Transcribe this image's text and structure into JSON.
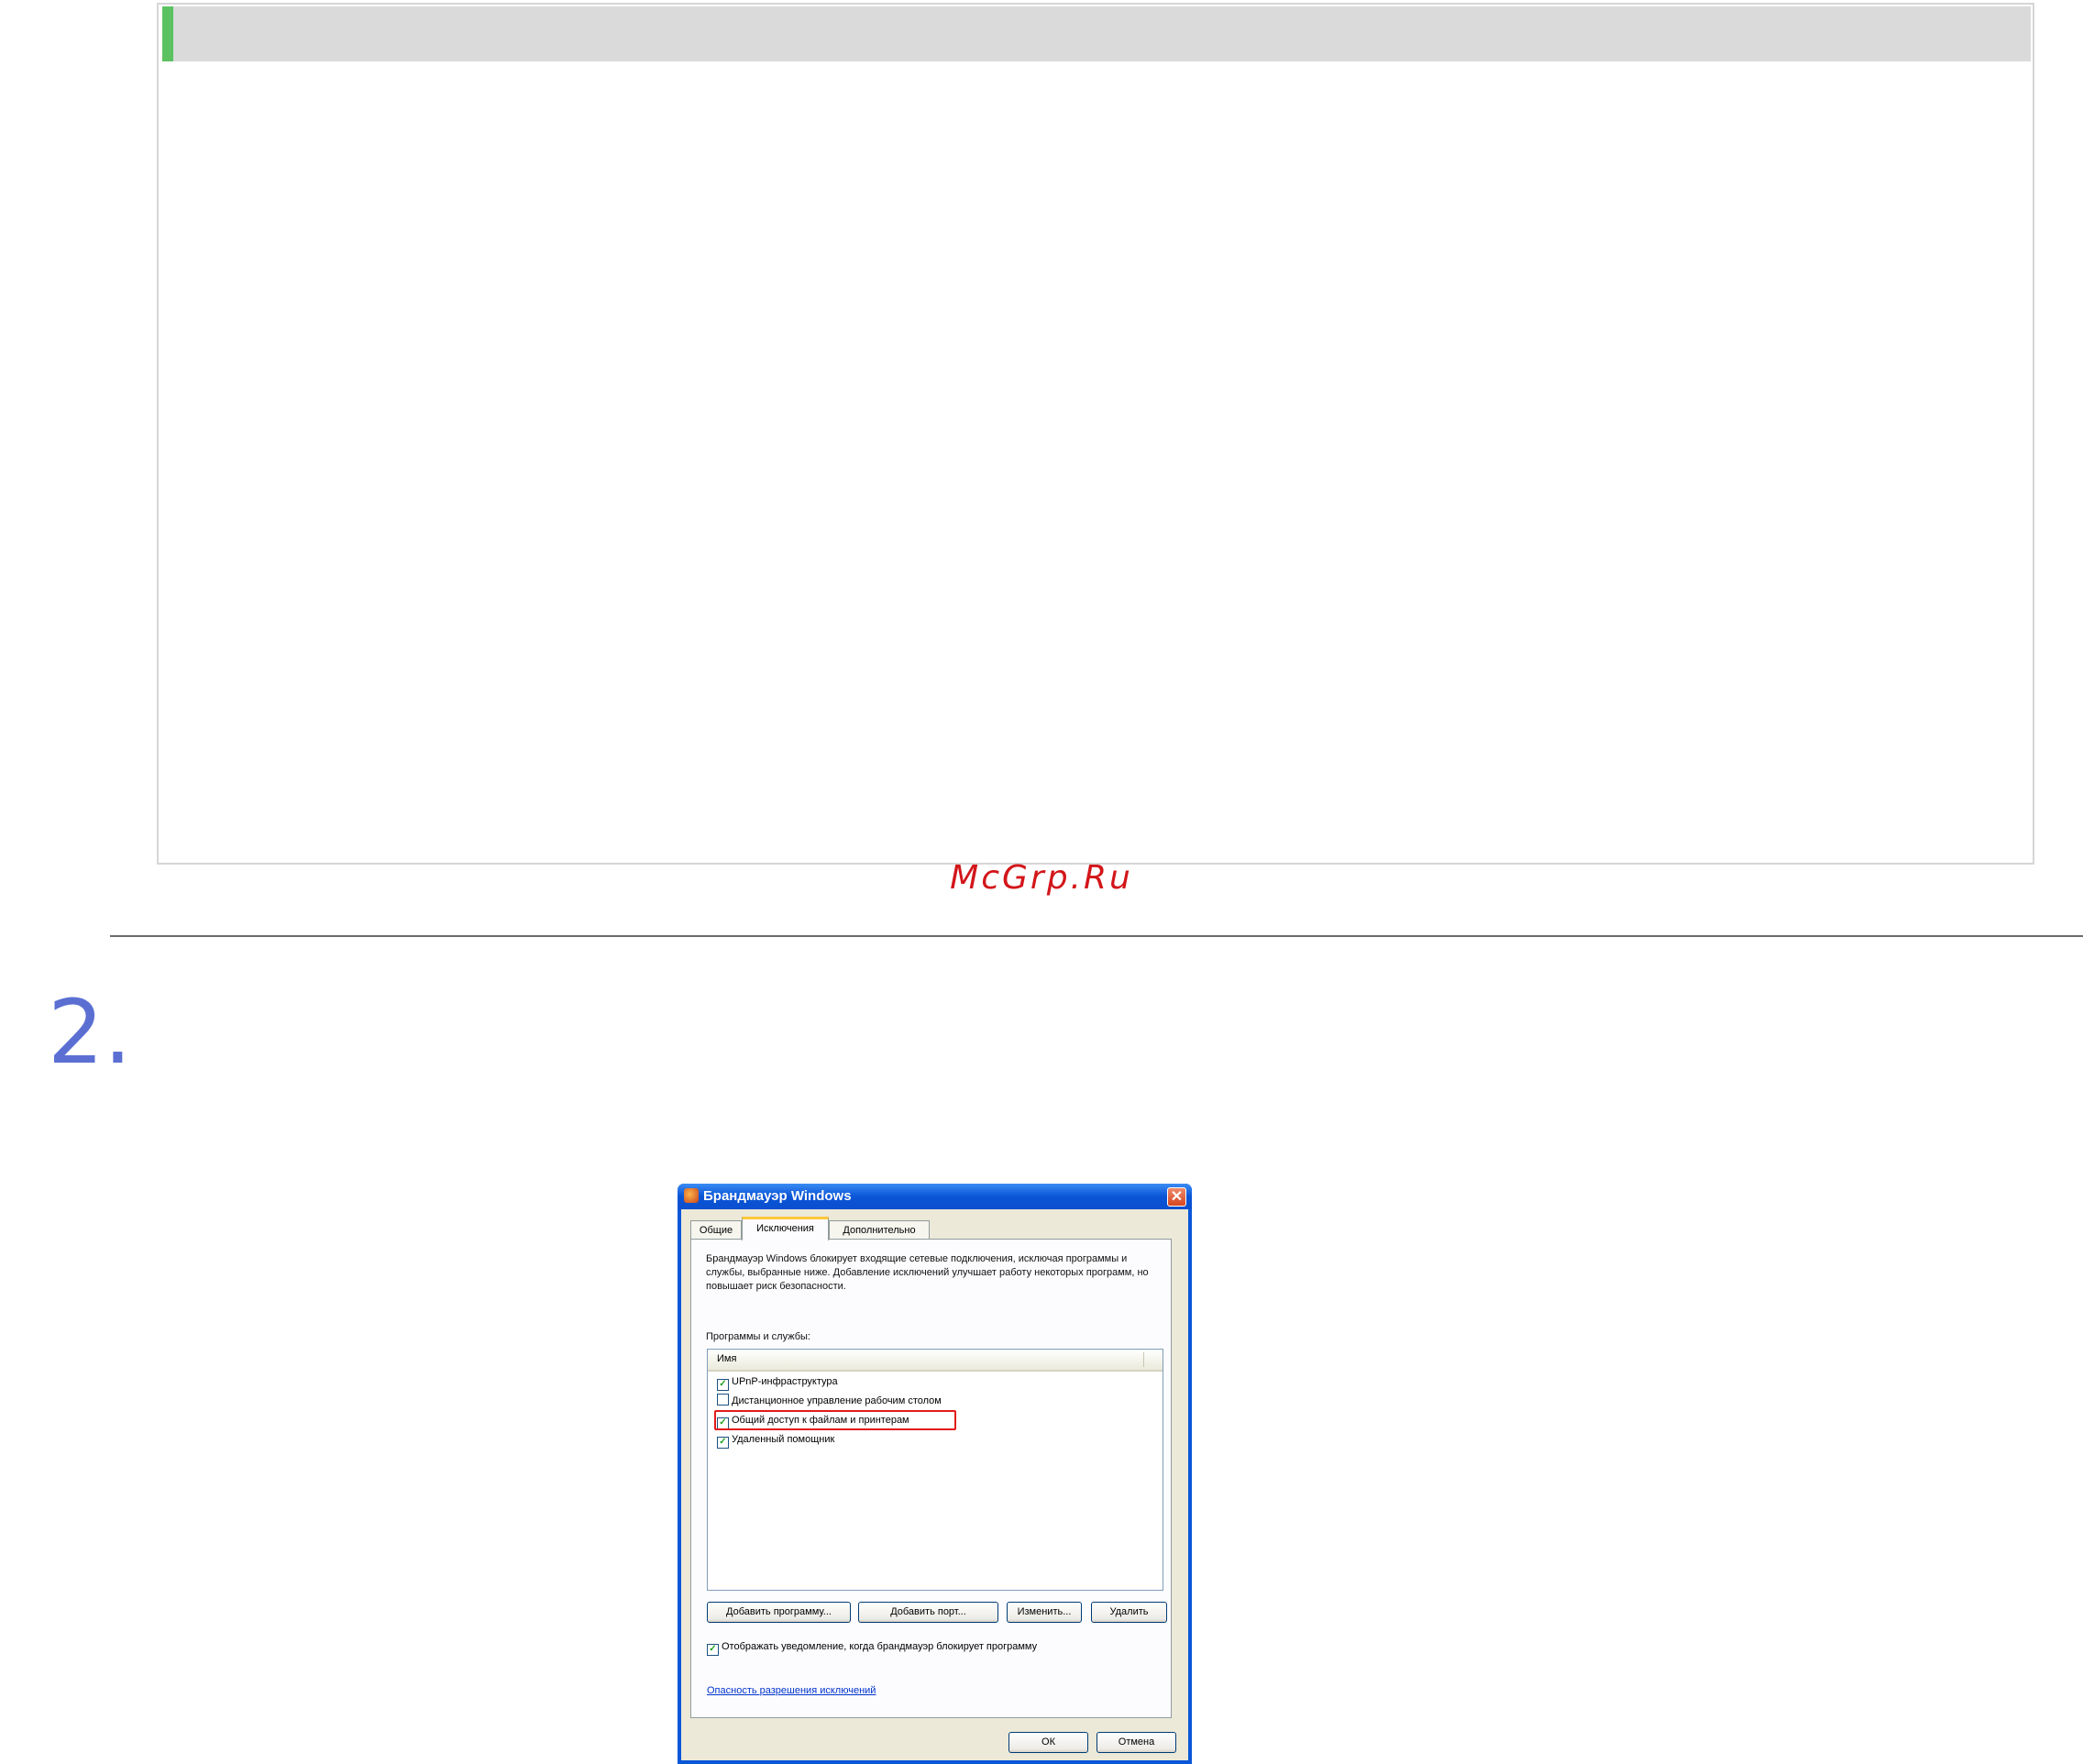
{
  "watermark": "McGrp.Ru",
  "step": {
    "number": "2."
  },
  "colors": {
    "accent_bar": "#5cc261",
    "watermark": "#d3161a",
    "step_number": "#5b6fd3",
    "highlight": "#e31b1b"
  },
  "dialog": {
    "title": "Брандмауэр Windows",
    "close_glyph": "✕",
    "tabs": [
      {
        "label": "Общие",
        "active": false
      },
      {
        "label": "Исключения",
        "active": true
      },
      {
        "label": "Дополнительно",
        "active": false
      }
    ],
    "description": "Брандмауэр Windows блокирует входящие сетевые подключения, исключая программы и службы, выбранные ниже. Добавление исключений улучшает работу некоторых программ, но повышает риск безопасности.",
    "group_label": "Программы и службы:",
    "list_header": "Имя",
    "items": [
      {
        "label": "UPnP-инфраструктура",
        "checked": true
      },
      {
        "label": "Дистанционное управление рабочим столом",
        "checked": false
      },
      {
        "label": "Общий доступ к файлам и принтерам",
        "checked": true,
        "highlighted": true
      },
      {
        "label": "Удаленный помощник",
        "checked": true
      }
    ],
    "buttons": {
      "add_program": "Добавить программу...",
      "add_port": "Добавить порт...",
      "edit": "Изменить...",
      "delete": "Удалить"
    },
    "notify": {
      "label": "Отображать уведомление, когда брандмауэр блокирует программу",
      "checked": true
    },
    "link": "Опасность разрешения исключений",
    "ok": "ОК",
    "cancel": "Отмена"
  }
}
